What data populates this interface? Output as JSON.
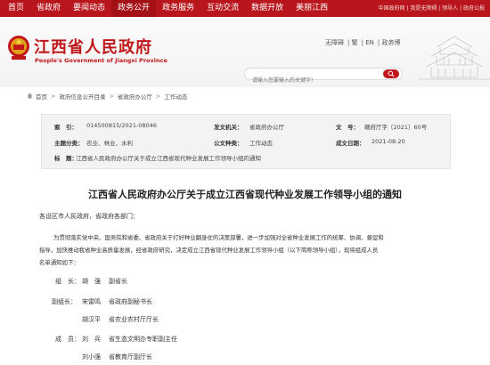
{
  "nav": {
    "items": [
      "首页",
      "省政府",
      "要闻动态",
      "政务公开",
      "政务服务",
      "互动交流",
      "数据开放",
      "美丽江西"
    ],
    "right_text": "中国政府网 | 我是无障碍 | 领导人 | 政府公报"
  },
  "header": {
    "title": "江西省人民政府",
    "subtitle": "People's Government of Jiangxi Province",
    "util": [
      "无障碍",
      "繁",
      "EN",
      "政务博"
    ],
    "search_placeholder": "请输入您要输入的关键字!"
  },
  "breadcrumb": [
    "首页",
    "政府信息公开目录",
    "省政府办公厅",
    "工作动态"
  ],
  "meta": {
    "index_label": "索　引：",
    "index_value": "014500815/2021-08046",
    "org_label": "发文机关：",
    "org_value": "省政府办公厅",
    "doc_label": "文　号：",
    "doc_value": "赣府厅字〔2021〕60号",
    "topic_label": "主题分类：",
    "topic_value": "农业、林业、水利",
    "type_label": "公文种类：",
    "type_value": "工作动态",
    "date_label": "成文日期：",
    "date_value": "2021-08-20",
    "subject_label": "标　题：",
    "subject_value": "江西省人民政府办公厅关于成立江西省现代种业发展工作领导小组的通知"
  },
  "article": {
    "title": "江西省人民政府办公厅关于成立江西省现代种业发展工作领导小组的通知",
    "greeting": "各设区市人民政府，省政府各部门：",
    "para1_line1": "为贯彻落实党中央、国务院和省委、省政府关于打好种业翻身仗的决策部署，进一步加强对全省种业发展工作的统筹、协调、督促和",
    "para1_line2": "指导，加快推动我省种业高质量发展，经省政府研究，决定成立江西省现代种业发展工作领导小组（以下简称领导小组），现将组成人员",
    "para1_line3": "名单通知如下：",
    "roles": [
      {
        "label": "组　长：",
        "name": "胡　强",
        "title": "副省长"
      },
      {
        "label": "副组长：",
        "name": "宋雷鸣",
        "title": "省政府副秘书长"
      },
      {
        "label": "",
        "name": "胡汉平",
        "title": "省农业农村厅厅长"
      },
      {
        "label": "成　员：",
        "name": "刘　兵",
        "title": "省生态文明办专职副主任"
      },
      {
        "label": "",
        "name": "刘小强",
        "title": "省教育厅副厅长"
      }
    ]
  },
  "colors": {
    "brand_red": "#b8161c",
    "title_red": "#c0171b"
  }
}
